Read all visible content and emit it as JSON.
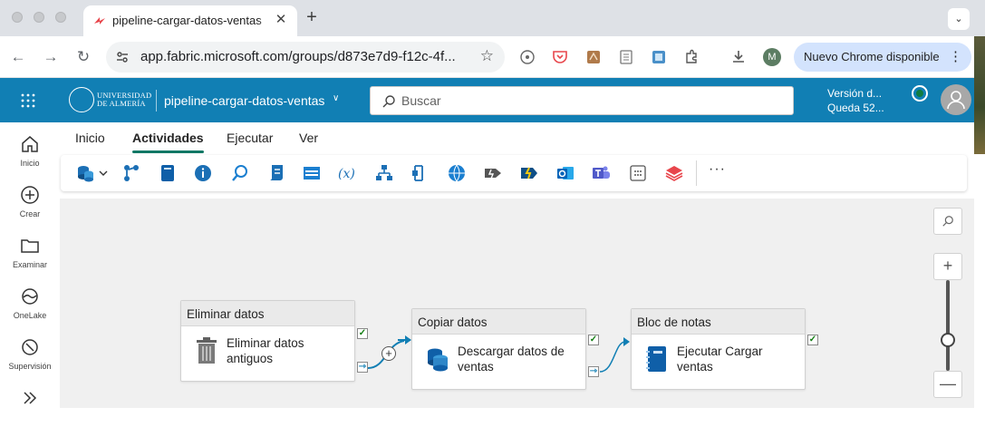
{
  "browser": {
    "tab_title": "pipeline-cargar-datos-ventas",
    "tab_close_glyph": "✕",
    "new_tab_glyph": "+",
    "tab_menu_glyph": "⌄",
    "url": "app.fabric.microsoft.com/groups/d873e7d9-f12c-4f...",
    "back_glyph": "←",
    "forward_glyph": "→",
    "reload_glyph": "↻",
    "star_glyph": "☆",
    "profile_initial": "M",
    "update_label": "Nuevo Chrome disponible",
    "update_menu_glyph": "⋮"
  },
  "header": {
    "org_name": "UNIVERSIDAD DE ALMERÍA",
    "item_name": "pipeline-cargar-datos-ventas",
    "item_chevron": "∨",
    "search_placeholder": "Buscar",
    "trial_line1": "Versión d...",
    "trial_line2": "Queda 52..."
  },
  "leftnav": {
    "items": [
      {
        "label": "Inicio",
        "icon": "home-icon"
      },
      {
        "label": "Crear",
        "icon": "create-icon"
      },
      {
        "label": "Examinar",
        "icon": "browse-folder-icon"
      },
      {
        "label": "OneLake",
        "icon": "onelake-icon"
      },
      {
        "label": "Supervisión",
        "icon": "monitor-icon"
      },
      {
        "label": "",
        "icon": "workloads-icon"
      }
    ]
  },
  "ribbon": {
    "tabs": [
      {
        "label": "Inicio",
        "active": false
      },
      {
        "label": "Actividades",
        "active": true
      },
      {
        "label": "Ejecutar",
        "active": false
      },
      {
        "label": "Ver",
        "active": false
      }
    ],
    "more_glyph": "···",
    "tools": [
      "copy-data-dropdown-icon",
      "dataflow-icon",
      "notebook-icon",
      "get-metadata-icon",
      "lookup-icon",
      "script-icon",
      "stored-procedure-icon",
      "set-variable-icon",
      "if-condition-icon",
      "switch-icon",
      "web-icon",
      "webhook-icon",
      "azure-function-icon",
      "outlook-icon",
      "teams-icon",
      "foreach-icon",
      "layers-icon"
    ]
  },
  "canvas": {
    "activities": [
      {
        "type": "Eliminar datos",
        "name": "Eliminar datos antiguos",
        "icon": "trash-icon"
      },
      {
        "type": "Copiar datos",
        "name": "Descargar datos de ventas",
        "icon": "copy-data-icon"
      },
      {
        "type": "Bloc de notas",
        "name": "Ejecutar Cargar ventas",
        "icon": "notebook-icon"
      }
    ],
    "port_success_glyph": "✓",
    "port_completion_glyph": "⇾",
    "add_glyph": "+",
    "zoom": {
      "in_glyph": "+",
      "out_glyph": "—",
      "level": 0.45
    }
  }
}
